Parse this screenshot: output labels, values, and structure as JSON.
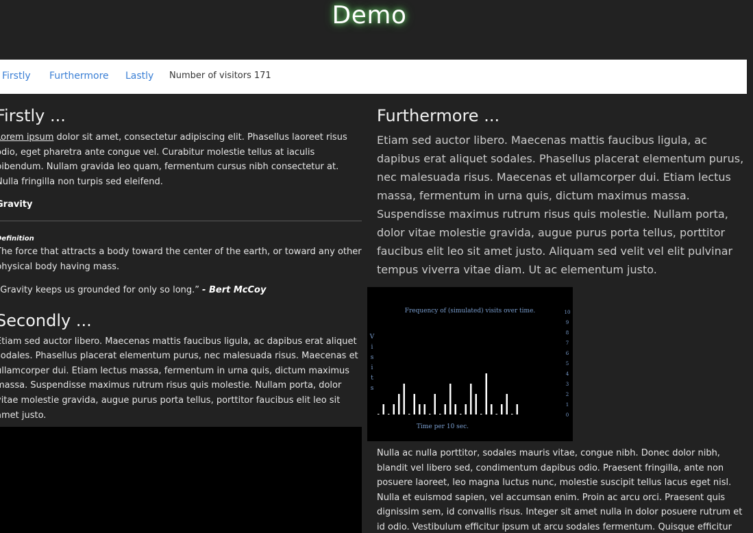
{
  "page": {
    "title": "Demo"
  },
  "nav": {
    "links": [
      "Firstly",
      "Furthermore",
      "Lastly"
    ],
    "visitor_label": "Number of visitors",
    "visitor_count": "171"
  },
  "left": {
    "firstly": {
      "heading": "Firstly ...",
      "link_text": "Lorem ipsum",
      "body": "dolor sit amet, consectetur adipiscing elit. Phasellus laoreet risus odio, eget pharetra ante congue vel. Curabitur molestie tellus at iaculis bibendum. Nullam gravida leo quam, fermentum cursus nibh consectetur at. Nulla fringilla non turpis sed eleifend."
    },
    "gravity": {
      "term": "Gravity",
      "definition_label": "Definition",
      "definition": "The force that attracts a body toward the center of the earth, or toward any other physical body having mass.",
      "quote": "“Gravity keeps us grounded for only so long.”",
      "quote_author": "- Bert McCoy"
    },
    "secondly": {
      "heading": "Secondly ...",
      "body": "Etiam sed auctor libero. Maecenas mattis faucibus ligula, ac dapibus erat aliquet sodales. Phasellus placerat elementum purus, nec malesuada risus. Maecenas et ullamcorper dui. Etiam lectus massa, fermentum in urna quis, dictum maximus massa. Suspendisse maximus rutrum risus quis molestie. Nullam porta, dolor vitae molestie gravida, augue purus porta tellus, porttitor faucibus elit leo sit amet justo."
    }
  },
  "right": {
    "furthermore": {
      "heading": "Furthermore ...",
      "body": "Etiam sed auctor libero. Maecenas mattis faucibus ligula, ac dapibus erat aliquet sodales. Phasellus placerat elementum purus, nec malesuada risus. Maecenas et ullamcorper dui. Etiam lectus massa, fermentum in urna quis, dictum maximus massa. Suspendisse maximus rutrum risus quis molestie. Nullam porta, dolor vitae molestie gravida, augue purus porta tellus, porttitor faucibus elit leo sit amet justo. Aliquam sed velit vel elit pulvinar tempus viverra vitae diam. Ut ac elementum justo."
    },
    "closing_body": "Nulla ac nulla porttitor, sodales mauris vitae, congue nibh. Donec dolor nibh, blandit vel libero sed, condimentum dapibus odio. Praesent fringilla, ante non posuere laoreet, leo magna luctus nunc, molestie suscipit tellus lacus eget nisl. Nulla et euismod sapien, vel accumsan enim. Proin ac arcu orci. Praesent quis dignissim sem, id convallis risus. Integer sit amet nulla in dolor posuere rutrum et id odio. Vestibulum efficitur ipsum ut arcu sodales fermentum. Quisque efficitur"
  },
  "colors": {
    "page_bg": "#222222",
    "title_glow": "#6fd46f",
    "nav_link": "#3a7fd5",
    "chart_bg": "#000000",
    "chart_text": "#7a9ecf",
    "chart_bar": "#ffffff"
  },
  "chart_data": {
    "type": "bar",
    "title": "Frequency of (simulated) visits over time.",
    "xlabel": "Time per 10 sec.",
    "ylabel": "Visits",
    "ylim": [
      0,
      10
    ],
    "ytick_labels": [
      "10",
      "9",
      "8",
      "7",
      "6",
      "5",
      "4",
      "3",
      "2",
      "1",
      "0"
    ],
    "values": [
      0,
      1,
      0,
      1,
      2,
      3,
      0,
      2,
      1,
      1,
      0,
      2,
      0,
      1,
      3,
      1,
      0,
      1,
      3,
      2,
      0,
      4,
      1,
      0,
      1,
      2,
      0,
      1
    ]
  }
}
